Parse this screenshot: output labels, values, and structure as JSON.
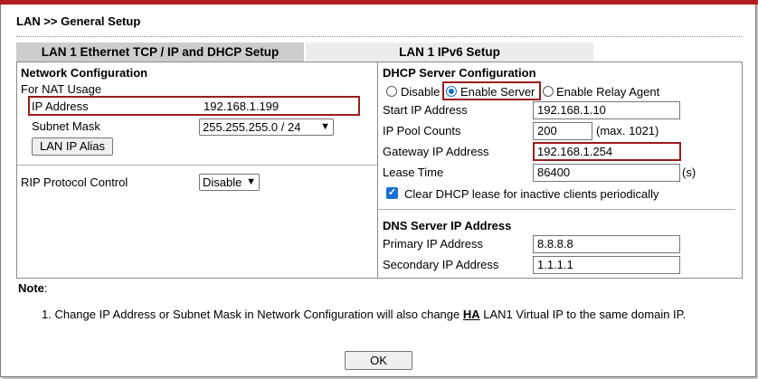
{
  "page": {
    "title": "LAN >> General Setup"
  },
  "tabs": [
    {
      "label": "LAN 1 Ethernet TCP / IP and DHCP Setup",
      "active": true
    },
    {
      "label": "LAN 1 IPv6 Setup",
      "active": false
    }
  ],
  "network": {
    "heading": "Network Configuration",
    "for_nat": "For NAT Usage",
    "ip_label": "IP Address",
    "ip_value": "192.168.1.199",
    "mask_label": "Subnet Mask",
    "mask_value": "255.255.255.0 / 24",
    "alias_button": "LAN IP Alias",
    "rip_label": "RIP Protocol Control",
    "rip_value": "Disable"
  },
  "dhcp": {
    "heading": "DHCP Server Configuration",
    "mode_options": [
      "Disable",
      "Enable Server",
      "Enable Relay Agent"
    ],
    "mode_selected": "Enable Server",
    "start_label": "Start IP Address",
    "start_value": "192.168.1.10",
    "pool_label": "IP Pool Counts",
    "pool_value": "200",
    "pool_max": "(max. 1021)",
    "gateway_label": "Gateway IP Address",
    "gateway_value": "192.168.1.254",
    "lease_label": "Lease Time",
    "lease_value": "86400",
    "lease_unit": "(s)",
    "clear_label": "Clear DHCP lease for inactive clients periodically",
    "clear_checked": true
  },
  "dns": {
    "heading": "DNS Server IP Address",
    "primary_label": "Primary IP Address",
    "primary_value": "8.8.8.8",
    "secondary_label": "Secondary IP Address",
    "secondary_value": "1.1.1.1"
  },
  "note": {
    "label": "Note",
    "colon": ":",
    "line_prefix": "1. Change IP Address or Subnet Mask in Network Configuration will also change ",
    "line_emphasis": "HA",
    "line_suffix": " LAN1 Virtual IP to the same domain IP."
  },
  "actions": {
    "ok_label": "OK"
  },
  "colors": {
    "accent_red": "#9b1c1c",
    "top_bar": "#b31e1e",
    "radio_blue": "#1a6fd6"
  }
}
